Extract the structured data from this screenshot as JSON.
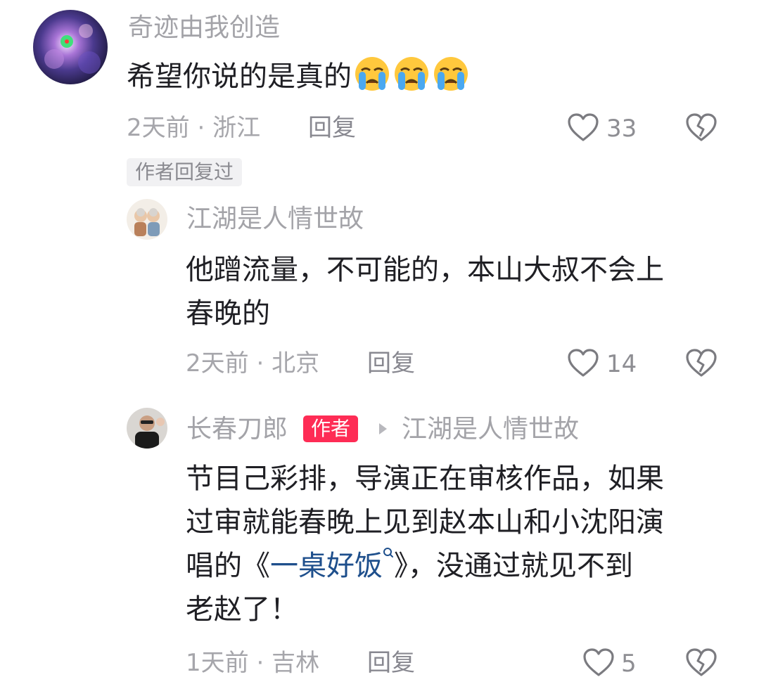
{
  "comments": [
    {
      "username": "奇迹由我创造",
      "text": "希望你说的是真的",
      "emoji": "loudly-crying-face",
      "emoji_count": 3,
      "time": "2天前",
      "location": "浙江",
      "reply_label": "回复",
      "likes": "33",
      "author_replied_tag": "作者回复过"
    },
    {
      "username": "江湖是人情世故",
      "text_line1": "他蹭流量，不可能的，本山大叔不会上",
      "text_line2": "春晚的",
      "time": "2天前",
      "location": "北京",
      "reply_label": "回复",
      "likes": "14"
    },
    {
      "username": "长春刀郎",
      "author_badge": "作者",
      "reply_to": "江湖是人情世故",
      "text_line1": "节目己彩排，导演正在审核作品，如果",
      "text_line2": "过审就能春晚上见到赵本山和小沈阳演",
      "text_line3_pre": "唱的《",
      "text_line3_link": "一桌好饭",
      "text_line3_post": "》，没通过就见不到",
      "text_line4": "老赵了！",
      "time": "1天前",
      "location": "吉林",
      "reply_label": "回复",
      "likes": "5"
    }
  ],
  "meta_separator": "·",
  "colors": {
    "accent_badge": "#fe2c55",
    "link": "#1e4f8c",
    "muted_text": "#a3a3a8",
    "body_text": "#1f1f24"
  }
}
